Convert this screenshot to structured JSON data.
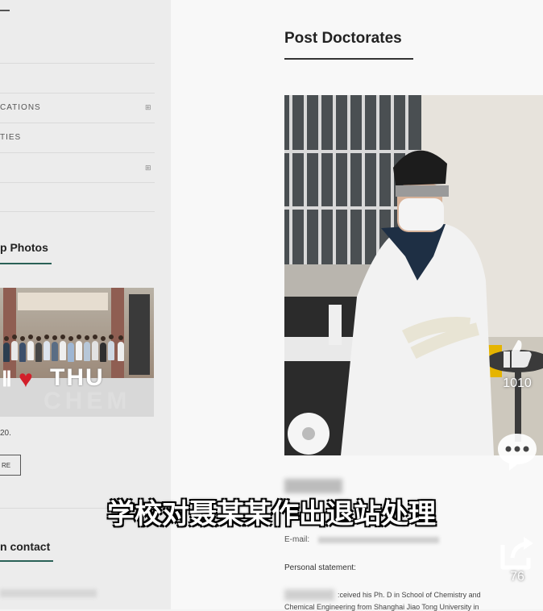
{
  "sidebar": {
    "links": [
      {
        "label": "CATIONS",
        "icon": "plus-icon"
      },
      {
        "label": "TIES",
        "icon": ""
      },
      {
        "label": "",
        "icon": "plus-icon"
      }
    ],
    "photos_heading": "p Photos",
    "photo_sign": {
      "thu": "THU",
      "chem": "CHEM"
    },
    "photo_date": "20.",
    "more_button": "RE",
    "contact_heading": "n contact"
  },
  "main": {
    "section_title": "Post Doctorates",
    "email_label": "E-mail:",
    "personal_statement_label": "Personal statement:",
    "statement_line1": ":ceived his Ph. D in School of Chemistry and",
    "statement_line2": "Chemical Engineering from Shanghai Jiao Tong University in"
  },
  "video_overlay": {
    "subtitle": "学校对聂某某作出退站处理",
    "like_count": "1010",
    "comment_icon": "comment-bubble-icon",
    "share_count": "76",
    "share_icon": "share-icon",
    "like_icon": "thumbs-up-icon"
  },
  "colors": {
    "accent": "#2a6157",
    "heart": "#d21f2a"
  }
}
